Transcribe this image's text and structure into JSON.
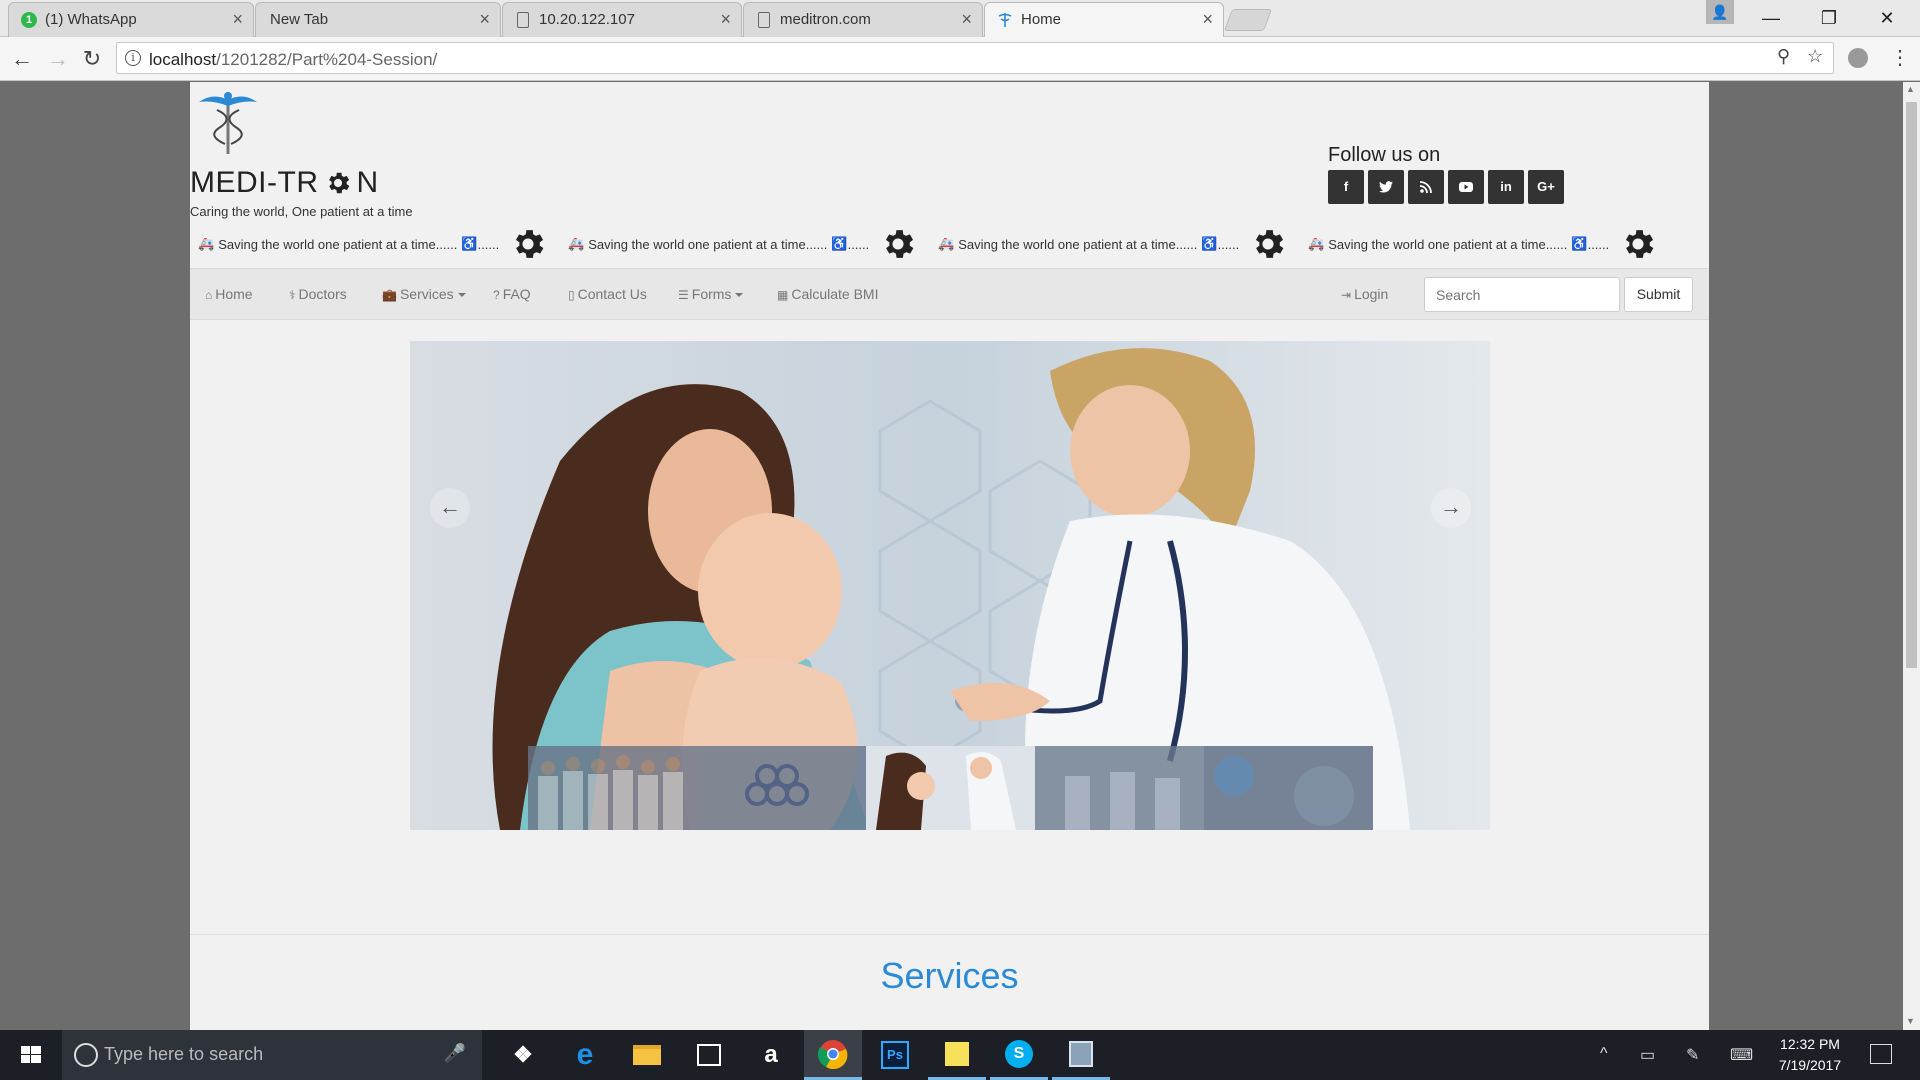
{
  "browser": {
    "tabs": [
      {
        "title": "(1) WhatsApp",
        "favicon": "whatsapp-icon",
        "badge": "1",
        "active": false
      },
      {
        "title": "New Tab",
        "favicon": "none",
        "active": false
      },
      {
        "title": "10.20.122.107",
        "favicon": "document-icon",
        "active": false
      },
      {
        "title": "meditron.com",
        "favicon": "document-icon",
        "active": false
      },
      {
        "title": "Home",
        "favicon": "caduceus-icon",
        "active": true
      }
    ],
    "url_host": "localhost",
    "url_path": "/1201282/Part%204-Session/"
  },
  "site": {
    "brand_prefix": "MEDI-TR",
    "brand_suffix": "N",
    "tagline": "Caring the world, One patient at a time",
    "follow_title": "Follow us on",
    "social": [
      {
        "name": "facebook",
        "glyph": "f"
      },
      {
        "name": "twitter",
        "glyph": "🐦"
      },
      {
        "name": "rss",
        "glyph": "◉"
      },
      {
        "name": "youtube",
        "glyph": "▶"
      },
      {
        "name": "linkedin",
        "glyph": "in"
      },
      {
        "name": "google-plus",
        "glyph": "G+"
      }
    ],
    "marquee_text": "Saving the world one patient at a time......",
    "nav": {
      "home": "Home",
      "doctors": "Doctors",
      "services": "Services",
      "faq": "FAQ",
      "contact": "Contact Us",
      "forms": "Forms",
      "bmi": "Calculate BMI",
      "login": "Login",
      "search_placeholder": "Search",
      "submit": "Submit"
    },
    "carousel": {
      "prev": "←",
      "next": "→",
      "active_thumb": 2,
      "thumb_count": 5
    },
    "services_title": "Services"
  },
  "taskbar": {
    "search_placeholder": "Type here to search",
    "time": "12:32 PM",
    "date": "7/19/2017",
    "apps": [
      "dropbox",
      "edge",
      "file-explorer",
      "store",
      "amazon",
      "chrome",
      "photoshop",
      "sticky-notes",
      "skype",
      "app"
    ]
  },
  "colors": {
    "accent": "#2a8ad6",
    "navbar_bg": "#e7e7e7",
    "page_bg": "#f1f1f1",
    "social_bg": "#333333"
  }
}
